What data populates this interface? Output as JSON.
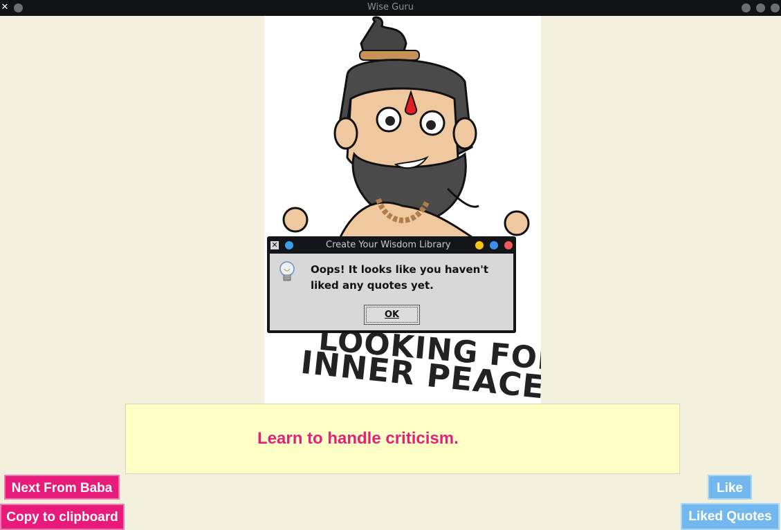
{
  "window": {
    "title": "Wise Guru"
  },
  "artwork": {
    "line1": "LOOKING FOR",
    "line2": "INNER PEACE.."
  },
  "quote": {
    "text": "Learn to handle criticism."
  },
  "buttons": {
    "next": "Next From Baba",
    "copy": "Copy to clipboard",
    "like": "Like",
    "liked": "Liked Quotes"
  },
  "dialog": {
    "title": "Create Your Wisdom Library",
    "message": "Oops! It looks like you haven't liked any quotes yet.",
    "ok": "OK"
  },
  "colors": {
    "background": "#f4f0de",
    "quote_bg": "#ffffc6",
    "quote_text": "#e0237a",
    "pink_button": "#e81a7a",
    "blue_button": "#72b8ef"
  },
  "icons": [
    "close-icon",
    "window-menu-icon",
    "minimize-icon",
    "maximize-icon",
    "lightbulb-icon"
  ]
}
